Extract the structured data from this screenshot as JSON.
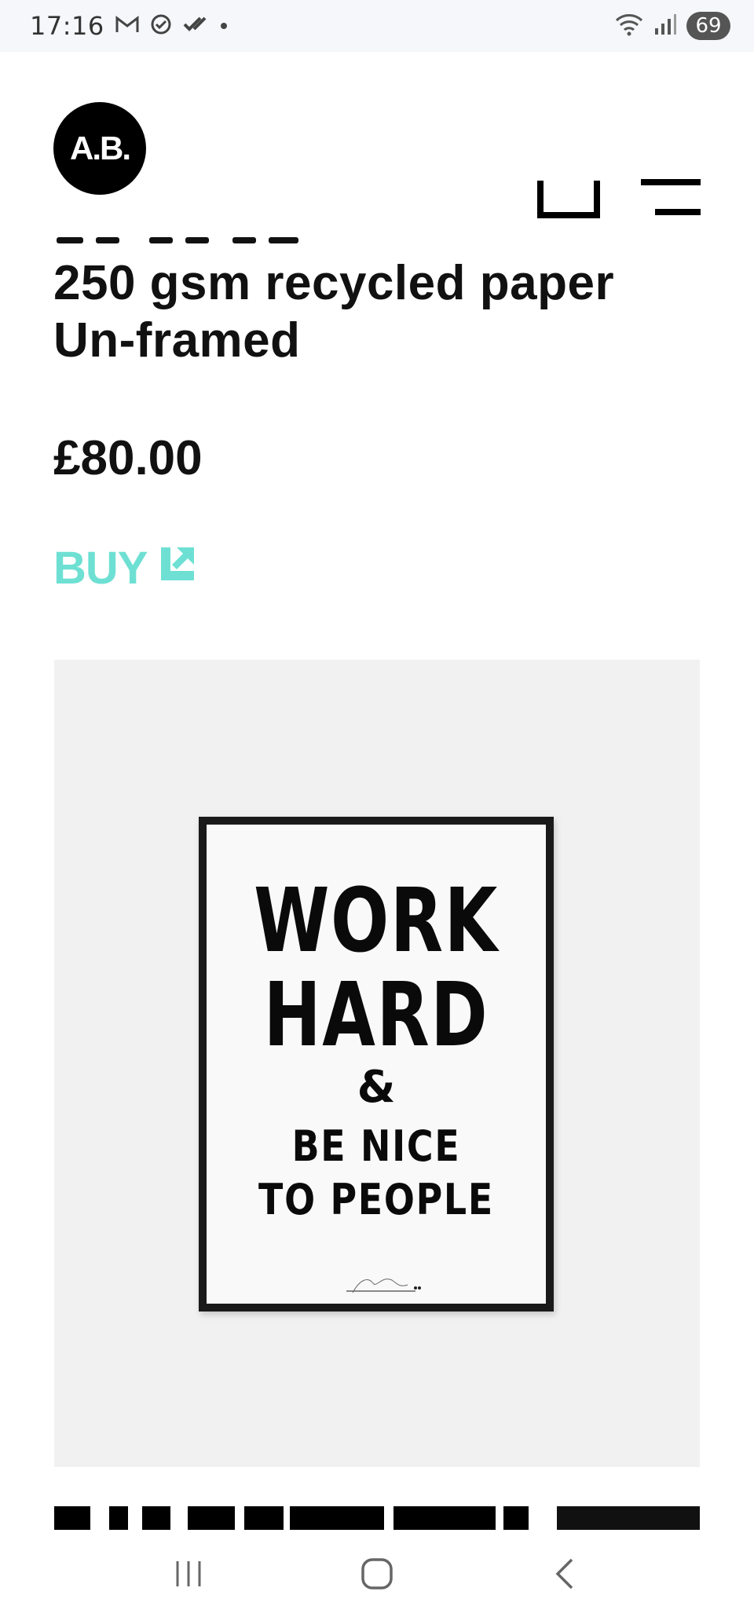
{
  "status_bar": {
    "time": "17:16",
    "battery": "69",
    "icons": [
      "gmail-icon",
      "check-circle-icon",
      "done-all-icon",
      "dot-icon",
      "wifi-icon",
      "signal-icon",
      "battery-icon"
    ]
  },
  "header": {
    "logo_text": "A.B.",
    "bag_icon": "shopping-bag-icon",
    "menu_icon": "hamburger-menu-icon"
  },
  "product": {
    "spec_lines": [
      "250 gsm recycled paper",
      "Un-framed"
    ],
    "price": "£80.00",
    "buy_label": "BUY",
    "buy_icon": "external-link-arrow-icon"
  },
  "poster": {
    "lines": [
      "WORK",
      "HARD",
      "&",
      "BE NICE",
      "TO PEOPLE"
    ]
  },
  "colors": {
    "accent": "#6ee0d3",
    "image_bg": "#f1f1f1",
    "text": "#111111"
  },
  "nav_bar": {
    "icons": [
      "recent-apps-icon",
      "home-icon",
      "back-icon"
    ]
  }
}
